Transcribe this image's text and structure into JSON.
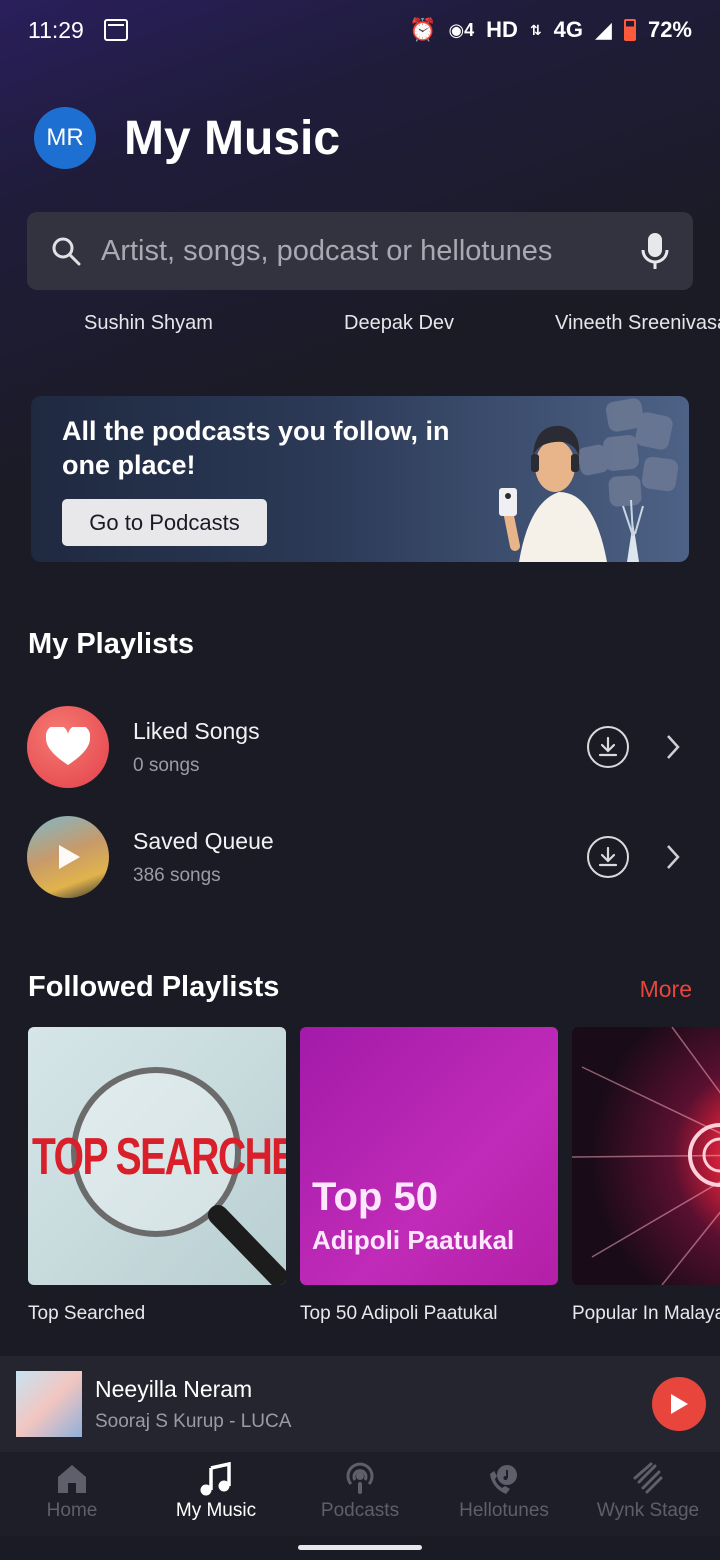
{
  "status": {
    "time": "11:29",
    "network": "HD",
    "signal": "4G",
    "battery": "72%"
  },
  "header": {
    "avatar_initials": "MR",
    "title": "My Music"
  },
  "search": {
    "placeholder": "Artist, songs, podcast or hellotunes"
  },
  "artist_chips": [
    "Sushin Shyam",
    "Deepak Dev",
    "Vineeth Sreenivasan"
  ],
  "banner": {
    "title": "All the podcasts you follow, in one place!",
    "button": "Go to Podcasts"
  },
  "my_playlists": {
    "title": "My Playlists",
    "items": [
      {
        "name": "Liked Songs",
        "count": "0 songs"
      },
      {
        "name": "Saved Queue",
        "count": "386 songs"
      }
    ]
  },
  "followed": {
    "title": "Followed Playlists",
    "more": "More",
    "items": [
      {
        "label": "Top Searched",
        "art_text": "TOP SEARCHED"
      },
      {
        "label": "Top 50 Adipoli Paatukal",
        "art_line1": "Top 50",
        "art_line2": "Adipoli Paatukal"
      },
      {
        "label": "Popular In Malayalam"
      }
    ]
  },
  "mini_player": {
    "song": "Neeyilla Neram",
    "artist": "Sooraj S Kurup - LUCA"
  },
  "nav": [
    "Home",
    "My Music",
    "Podcasts",
    "Hellotunes",
    "Wynk Stage"
  ],
  "colors": {
    "accent": "#e8453c",
    "avatar": "#1e6fd2",
    "background": "#1b1b26"
  }
}
